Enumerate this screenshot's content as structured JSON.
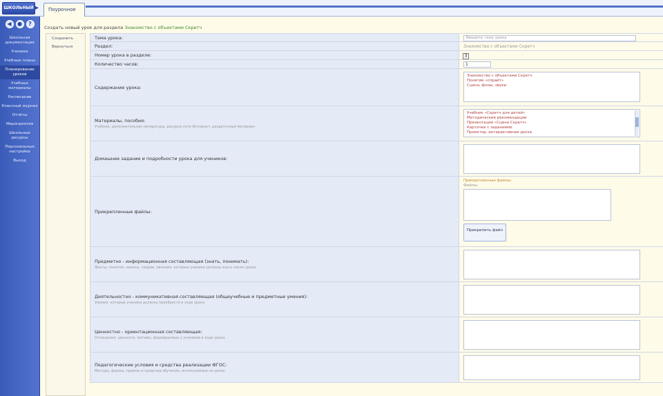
{
  "app": {
    "logo_text": "ШКОЛЬНЫЙ",
    "tab_title": "Поурочное планирование"
  },
  "sidebar": {
    "icons": [
      {
        "name": "back-icon",
        "glyph": "◀"
      },
      {
        "name": "home-icon",
        "glyph": "●"
      },
      {
        "name": "help-icon",
        "glyph": "?"
      }
    ],
    "items": [
      {
        "label": "Школьная документация"
      },
      {
        "label": "Ученики"
      },
      {
        "label": "Учебные планы"
      },
      {
        "label": "Планирование уроков",
        "active": true
      },
      {
        "label": "Учебные материалы"
      },
      {
        "label": "Расписание"
      },
      {
        "label": "Классный журнал"
      },
      {
        "label": "Отчёты"
      },
      {
        "label": "Мероприятия"
      },
      {
        "label": "Школьные ресурсы"
      },
      {
        "label": "Персональные настройки"
      },
      {
        "label": "Выход"
      }
    ]
  },
  "header": {
    "title": "Создать новый урок для раздела",
    "title_highlight": "Знакомство с объектами Скретч"
  },
  "left_panel": {
    "buttons": [
      {
        "name": "save-button",
        "label": "Сохранить"
      },
      {
        "name": "back-button",
        "label": "Вернуться"
      }
    ]
  },
  "form": {
    "rows": [
      {
        "label": "Тема урока:",
        "value_placeholder": "Введите тему урока"
      },
      {
        "label": "Раздел:",
        "value": "Знакомство с объектами Скретч"
      },
      {
        "label": "Номер урока в разделе:",
        "value": "3"
      },
      {
        "label": "Количество часов:",
        "value": "1"
      },
      {
        "label": "Содержание урока:",
        "value_lines": [
          "Знакомство с объектами Скретч",
          "Понятие «спрайт»",
          "Сцена, фоны, звуки"
        ]
      },
      {
        "label": "Материалы, пособия:",
        "hint": "Учебник, дополнительная литература, ресурсы сети Интернет, раздаточный материал",
        "value_lines": [
          "Учебник «Скретч для детей»",
          "Методические рекомендации",
          "Презентация «Сцена Скретч»",
          "Карточки с заданиями",
          "Проектор, интерактивная доска"
        ]
      },
      {
        "label": "Домашнее задание и подробности урока для учеников:"
      },
      {
        "label": "Прикрепленные файлы:",
        "files_label": "Прикрепленные файлы:",
        "files_sub": "Файлы:",
        "upload_label": "Прикрепить файл"
      },
      {
        "label": "Предметно - информационная составляющая (знать, понимать):",
        "hint": "Факты, понятия, законы, теории, явления, которые ученики должны знать после урока"
      },
      {
        "label": "Деятельностно - коммуникативная составляющая (общеучебные и предметные умения):",
        "hint": "Умения, которые ученики должны приобрести в ходе урока"
      },
      {
        "label": "Ценностно - ориентационная составляющая:",
        "hint": "Отношения, ценности, мотивы, формируемые у учеников в ходе урока"
      },
      {
        "label": "Педагогические условия и средства реализации ФГОС:",
        "hint": "Методы, формы, приемы и средства обучения, используемые на уроке"
      }
    ]
  },
  "colors": {
    "accent": "#5272c8",
    "label_bg": "#e4eaf6",
    "page_bg": "#fffbe9",
    "sidebar": "#3a5bb8"
  }
}
